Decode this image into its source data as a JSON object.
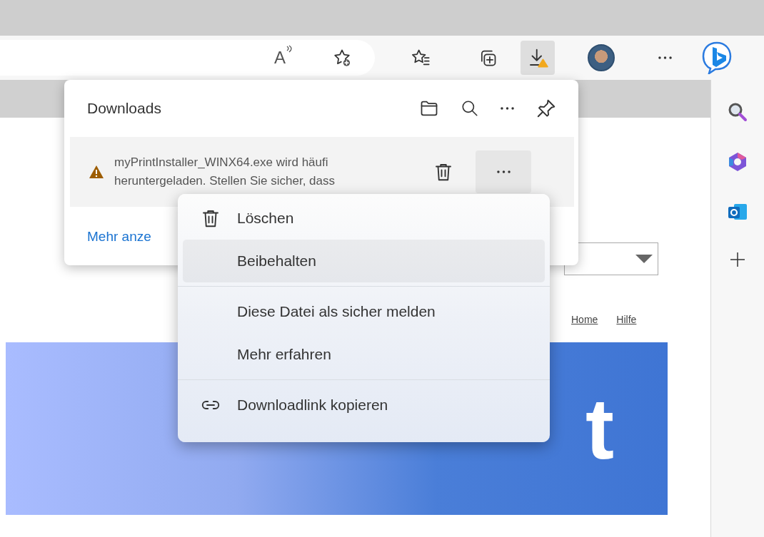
{
  "toolbar": {
    "read_aloud_glyph": "A",
    "downloads_active": true,
    "downloads_warning": true
  },
  "downloads_panel": {
    "title": "Downloads",
    "items": [
      {
        "warning": true,
        "message_lines": [
          "myPrintInstaller_WINX64.exe wird häufi",
          "heruntergeladen. Stellen Sie sicher, dass"
        ],
        "menu_open": true
      }
    ],
    "footer_link": "Mehr anze"
  },
  "context_menu": {
    "items": [
      {
        "kind": "delete",
        "label": "Löschen",
        "highlighted": false
      },
      {
        "kind": "plain",
        "label": "Beibehalten",
        "highlighted": true
      },
      {
        "kind": "separator"
      },
      {
        "kind": "plain",
        "label": "Diese Datei als sicher melden",
        "highlighted": false
      },
      {
        "kind": "plain",
        "label": "Mehr erfahren",
        "highlighted": false
      },
      {
        "kind": "separator"
      },
      {
        "kind": "copy-link",
        "label": "Downloadlink kopieren",
        "highlighted": false
      }
    ]
  },
  "web_page": {
    "links": [
      "Home",
      "Hilfe"
    ],
    "banner_title": "t"
  }
}
